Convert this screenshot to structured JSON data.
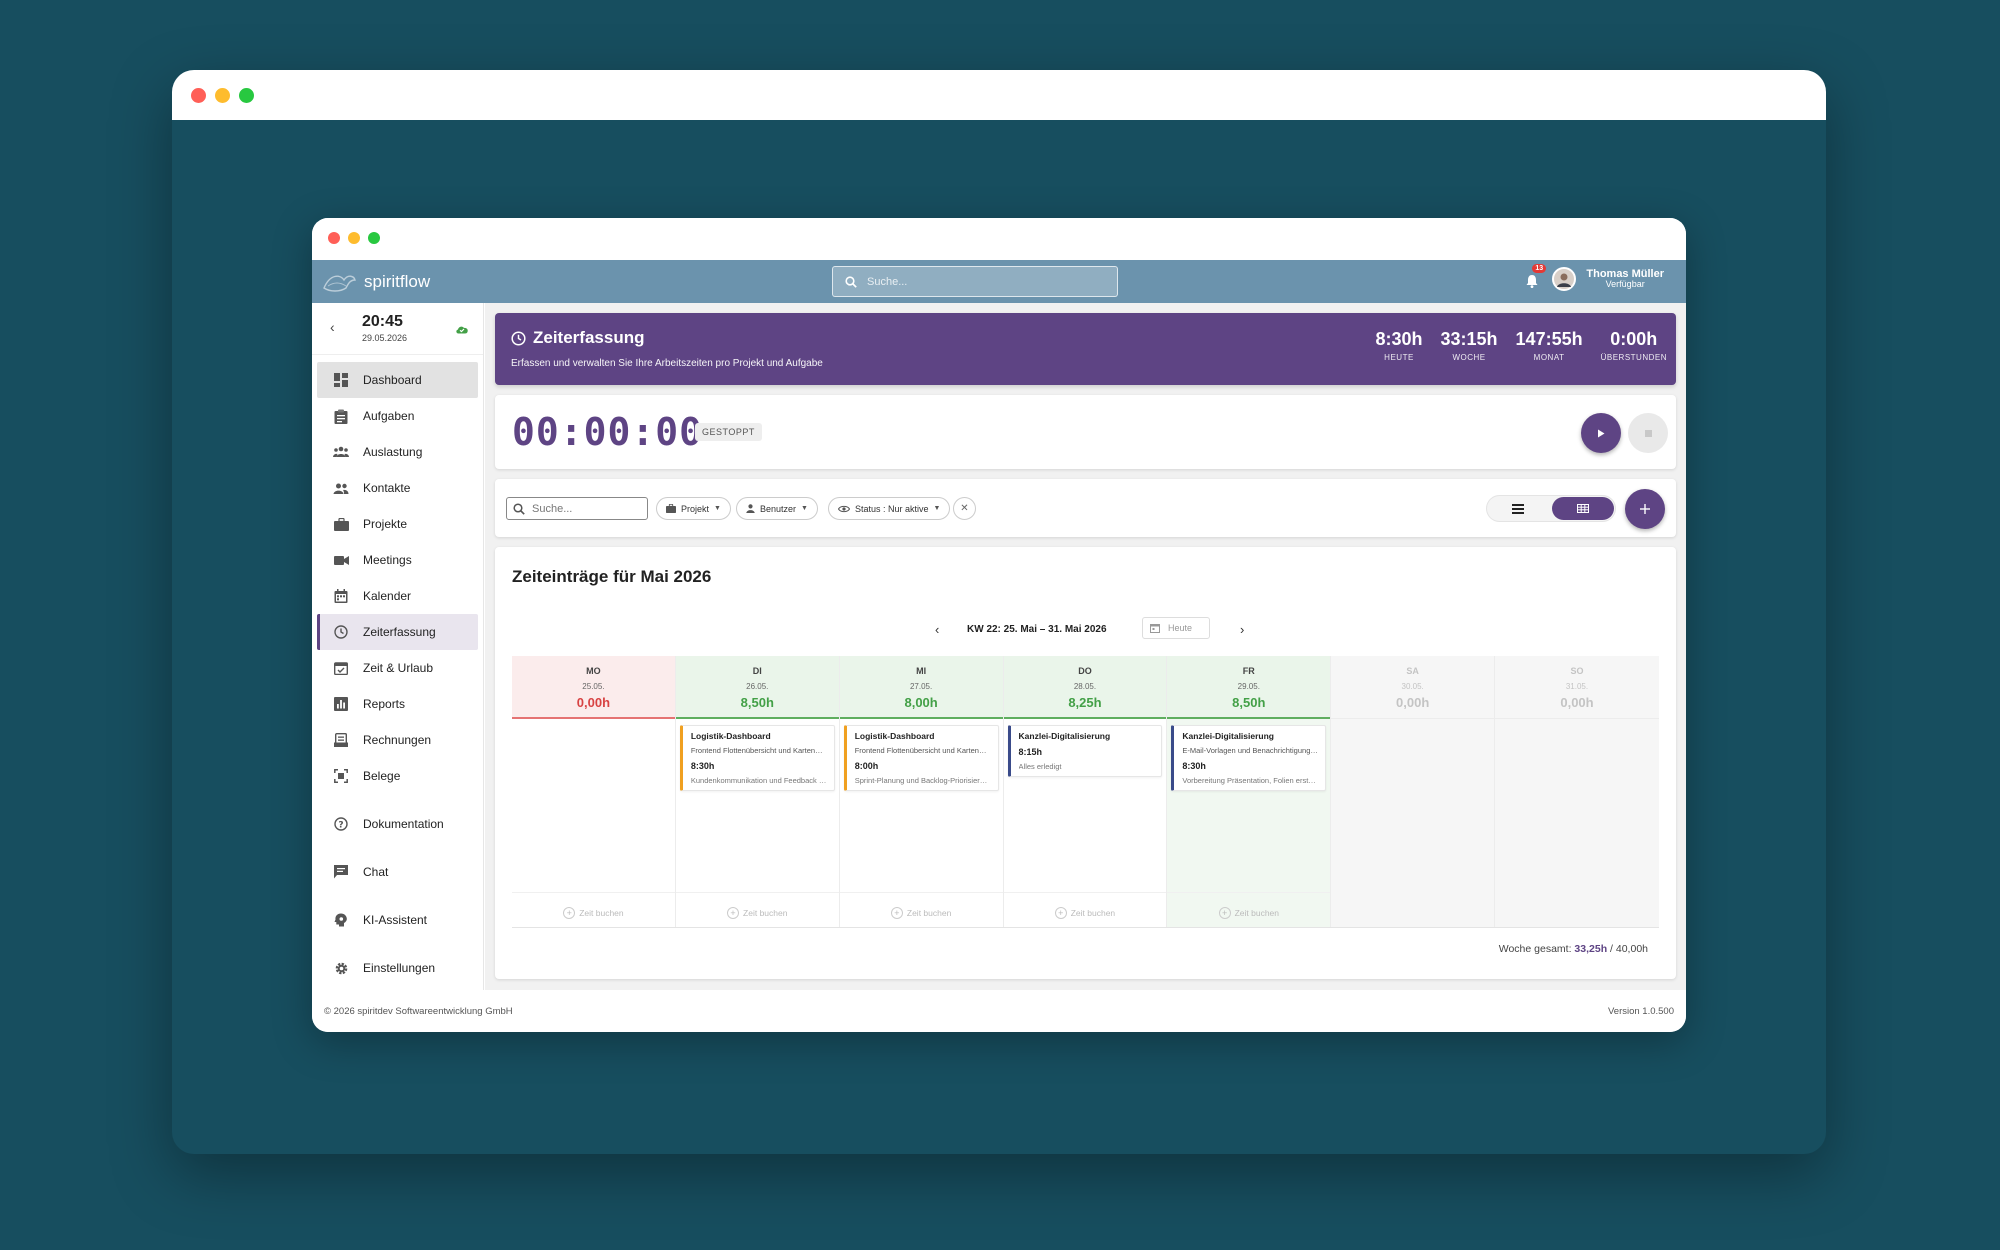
{
  "app": {
    "name": "spiritflow",
    "search_placeholder": "Suche...",
    "notifications_count": "13",
    "user_name": "Thomas Müller",
    "user_status": "Verfügbar"
  },
  "sidebar": {
    "time": "20:45",
    "date": "29.05.2026",
    "items": [
      {
        "label": "Dashboard",
        "icon": "dashboard-icon"
      },
      {
        "label": "Aufgaben",
        "icon": "clipboard-icon"
      },
      {
        "label": "Auslastung",
        "icon": "team-icon"
      },
      {
        "label": "Kontakte",
        "icon": "contacts-icon"
      },
      {
        "label": "Projekte",
        "icon": "briefcase-icon"
      },
      {
        "label": "Meetings",
        "icon": "video-icon"
      },
      {
        "label": "Kalender",
        "icon": "calendar-icon"
      },
      {
        "label": "Zeiterfassung",
        "icon": "clock-icon"
      },
      {
        "label": "Zeit & Urlaub",
        "icon": "calendar-check-icon"
      },
      {
        "label": "Reports",
        "icon": "bar-chart-icon"
      },
      {
        "label": "Rechnungen",
        "icon": "invoice-icon"
      },
      {
        "label": "Belege",
        "icon": "scan-icon"
      },
      {
        "label": "Dokumentation",
        "icon": "help-icon"
      },
      {
        "label": "Chat",
        "icon": "chat-icon"
      },
      {
        "label": "KI-Assistent",
        "icon": "ai-icon"
      },
      {
        "label": "Einstellungen",
        "icon": "gear-icon"
      }
    ]
  },
  "banner": {
    "title": "Zeiterfassung",
    "subtitle": "Erfassen und verwalten Sie Ihre Arbeitszeiten pro Projekt und Aufgabe",
    "stats": [
      {
        "value": "8:30h",
        "label": "HEUTE"
      },
      {
        "value": "33:15h",
        "label": "WOCHE"
      },
      {
        "value": "147:55h",
        "label": "MONAT"
      },
      {
        "value": "0:00h",
        "label": "ÜBERSTUNDEN"
      }
    ]
  },
  "timer": {
    "value": "00:00:00",
    "status": "GESTOPPT"
  },
  "filters": {
    "search_placeholder": "Suche...",
    "project": "Projekt",
    "user": "Benutzer",
    "status": "Status : Nur aktive"
  },
  "calendar": {
    "title": "Zeiteinträge für Mai 2026",
    "week_label": "KW 22: 25. Mai – 31. Mai 2026",
    "today_label": "Heute",
    "book_label": "Zeit buchen",
    "days": [
      {
        "name": "MO",
        "date": "25.05.",
        "hours": "0,00h"
      },
      {
        "name": "DI",
        "date": "26.05.",
        "hours": "8,50h",
        "entry": {
          "title": "Logistik-Dashboard",
          "desc": "Frontend Flottenübersicht und Kartenansicht",
          "hours": "8:30h",
          "note": "Kundenkommunikation und Feedback einarbeiten"
        }
      },
      {
        "name": "MI",
        "date": "27.05.",
        "hours": "8,00h",
        "entry": {
          "title": "Logistik-Dashboard",
          "desc": "Frontend Flottenübersicht und Kartenansicht",
          "hours": "8:00h",
          "note": "Sprint-Planung und Backlog-Priorisierung"
        }
      },
      {
        "name": "DO",
        "date": "28.05.",
        "hours": "8,25h",
        "entry": {
          "title": "Kanzlei-Digitalisierung",
          "hours": "8:15h",
          "note": "Alles erledigt"
        }
      },
      {
        "name": "FR",
        "date": "29.05.",
        "hours": "8,50h",
        "entry": {
          "title": "Kanzlei-Digitalisierung",
          "desc": "E-Mail-Vorlagen und Benachrichtigungen",
          "hours": "8:30h",
          "note": "Vorbereitung Präsentation, Folien erstellen"
        }
      },
      {
        "name": "SA",
        "date": "30.05.",
        "hours": "0,00h"
      },
      {
        "name": "SO",
        "date": "31.05.",
        "hours": "0,00h"
      }
    ],
    "week_total_label": "Woche gesamt:",
    "week_total_value": "33,25h",
    "week_target": "/ 40,00h"
  },
  "footer": {
    "copyright": "© 2026 spiritdev Softwareentwicklung GmbH",
    "version": "Version 1.0.500"
  },
  "colors": {
    "accent": "#5e4484",
    "appbar": "#6b93ad",
    "background": "#174e5f",
    "over": "#43a047",
    "under": "#d84343"
  }
}
